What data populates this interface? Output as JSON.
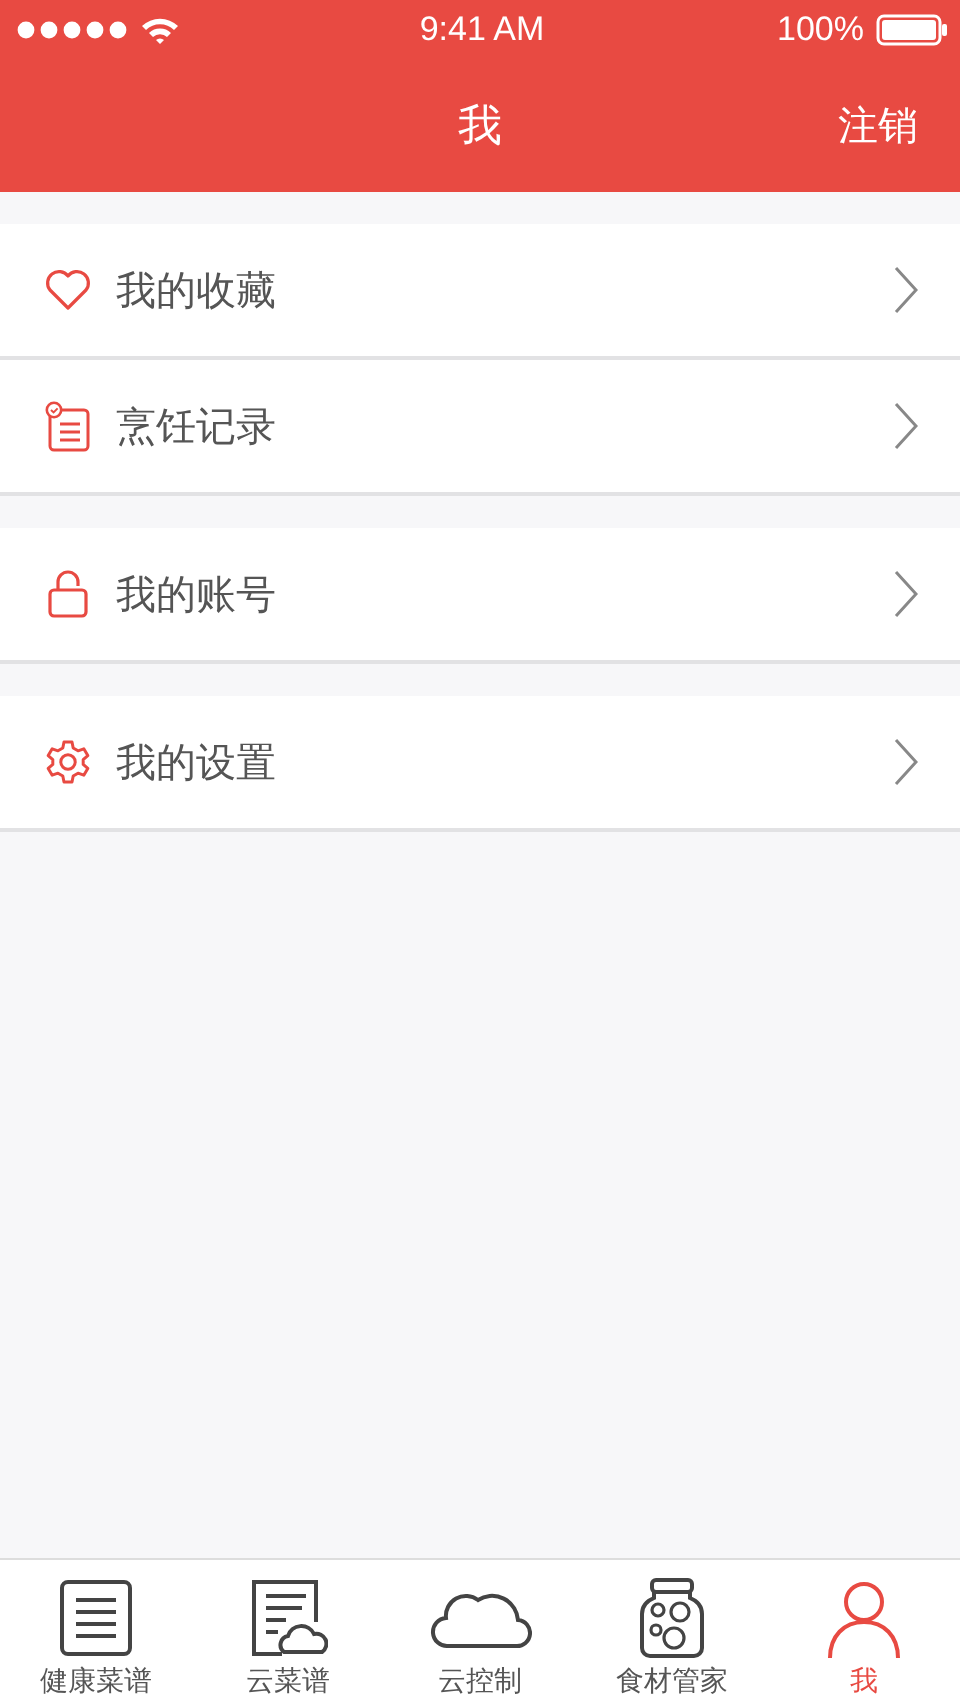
{
  "status_bar": {
    "time": "9:41 AM",
    "battery": "100%"
  },
  "nav_bar": {
    "title": "我",
    "action": "注销"
  },
  "menu_groups": [
    {
      "items": [
        {
          "label": "我的收藏"
        },
        {
          "label": "烹饪记录"
        }
      ]
    },
    {
      "items": [
        {
          "label": "我的账号"
        }
      ]
    },
    {
      "items": [
        {
          "label": "我的设置"
        }
      ]
    }
  ],
  "tab_bar": [
    {
      "label": "健康菜谱",
      "selected": false
    },
    {
      "label": "云菜谱",
      "selected": false
    },
    {
      "label": "云控制",
      "selected": false
    },
    {
      "label": "食材管家",
      "selected": false
    },
    {
      "label": "我",
      "selected": true
    }
  ]
}
